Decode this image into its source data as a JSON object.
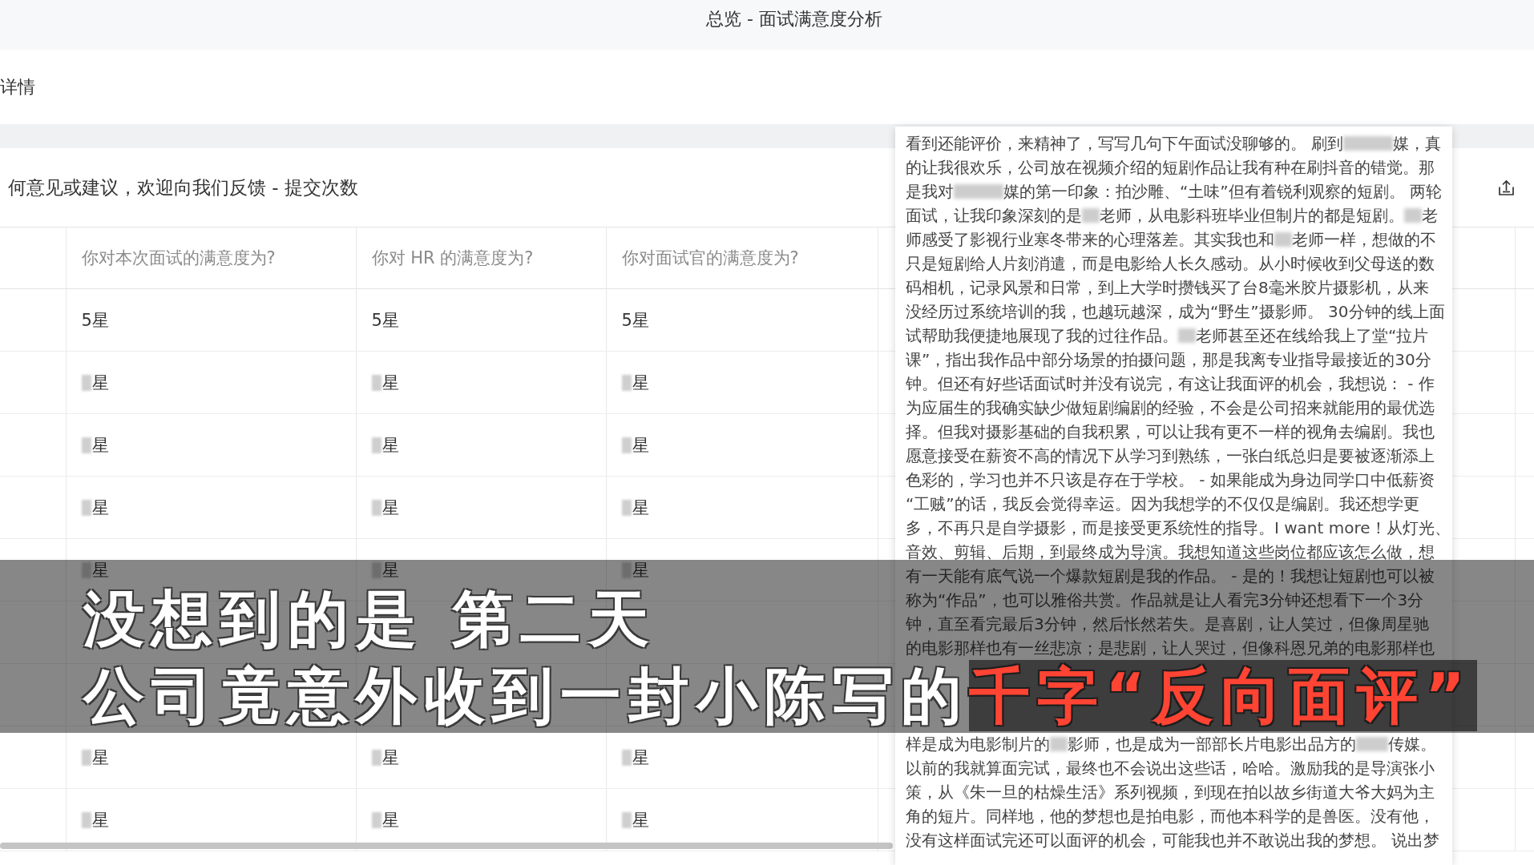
{
  "window": {
    "title": "总览 - 面试满意度分析"
  },
  "page_header": {
    "label": "详情"
  },
  "card": {
    "title": "何意见或建议，欢迎向我们反馈 - 提交次数"
  },
  "table": {
    "columns": [
      {
        "label": "你对本次面试的满意度为?"
      },
      {
        "label": "你对 HR 的满意度为?"
      },
      {
        "label": "你对面试官的满意度为?"
      }
    ],
    "rows": [
      {
        "cells": [
          {
            "text": "5星",
            "blurred": false
          },
          {
            "text": "5星",
            "blurred": false
          },
          {
            "text": "5星",
            "blurred": false
          }
        ]
      },
      {
        "cells": [
          {
            "text": "星",
            "blurred": true
          },
          {
            "text": "星",
            "blurred": true
          },
          {
            "text": "星",
            "blurred": true
          }
        ]
      },
      {
        "cells": [
          {
            "text": "星",
            "blurred": true
          },
          {
            "text": "星",
            "blurred": true
          },
          {
            "text": "星",
            "blurred": true
          }
        ]
      },
      {
        "cells": [
          {
            "text": "星",
            "blurred": true
          },
          {
            "text": "星",
            "blurred": true
          },
          {
            "text": "星",
            "blurred": true
          }
        ]
      },
      {
        "cells": [
          {
            "text": "星",
            "blurred": true
          },
          {
            "text": "星",
            "blurred": true
          },
          {
            "text": "星",
            "blurred": true
          }
        ]
      }
    ],
    "rows_after_caption": [
      {
        "cells": [
          {
            "text": "星",
            "blurred": true
          },
          {
            "text": "星",
            "blurred": true
          },
          {
            "text": "星",
            "blurred": true
          }
        ]
      },
      {
        "cells": [
          {
            "text": "星",
            "blurred": true
          },
          {
            "text": "星",
            "blurred": true
          },
          {
            "text": "星",
            "blurred": true
          }
        ]
      }
    ]
  },
  "review_panel": {
    "paragraphs": [
      {
        "lines": [
          {
            "segments": [
              {
                "kind": "text",
                "text": "看到还能评价，来精神了，写写几句下午面试没聊够的。 刷到"
              },
              {
                "kind": "blur3"
              },
              {
                "kind": "text",
                "text": "媒，真"
              }
            ]
          },
          {
            "segments": [
              {
                "kind": "text",
                "text": "的让我很欢乐，公司放在视频介绍的短剧作品让我有种在刷抖音的错觉。那"
              }
            ]
          },
          {
            "segments": [
              {
                "kind": "text",
                "text": "是我对"
              },
              {
                "kind": "blur3"
              },
              {
                "kind": "text",
                "text": "媒的第一印象：拍沙雕、“土味”但有着锐利观察的短剧。 两轮"
              }
            ]
          },
          {
            "segments": [
              {
                "kind": "text",
                "text": "面试，让我印象深刻的是"
              },
              {
                "kind": "blur1"
              },
              {
                "kind": "text",
                "text": "老师，从电影科班毕业但制片的都是短剧。"
              },
              {
                "kind": "blur1"
              },
              {
                "kind": "text",
                "text": "老"
              }
            ]
          },
          {
            "segments": [
              {
                "kind": "text",
                "text": "师感受了影视行业寒冬带来的心理落差。其实我也和"
              },
              {
                "kind": "blur1"
              },
              {
                "kind": "text",
                "text": "老师一样，想做的不"
              }
            ]
          },
          {
            "segments": [
              {
                "kind": "text",
                "text": "只是短剧给人片刻消遣，而是电影给人长久感动。从小时候收到父母送的数"
              }
            ]
          },
          {
            "segments": [
              {
                "kind": "text",
                "text": "码相机，记录风景和日常，到上大学时攒钱买了台8毫米胶片摄影机，从来"
              }
            ]
          },
          {
            "segments": [
              {
                "kind": "text",
                "text": "没经历过系统培训的我，也越玩越深，成为“野生”摄影师。 30分钟的线上面"
              }
            ]
          },
          {
            "segments": [
              {
                "kind": "text",
                "text": "试帮助我便捷地展现了我的过往作品。"
              },
              {
                "kind": "blur1"
              },
              {
                "kind": "text",
                "text": "老师甚至还在线给我上了堂“拉片"
              }
            ]
          },
          {
            "segments": [
              {
                "kind": "text",
                "text": "课”，指出我作品中部分场景的拍摄问题，那是我离专业指导最接近的30分"
              }
            ]
          },
          {
            "segments": [
              {
                "kind": "text",
                "text": "钟。但还有好些话面试时并没有说完，有这让我面评的机会，我想说： - 作"
              }
            ]
          },
          {
            "segments": [
              {
                "kind": "text",
                "text": "为应届生的我确实缺少做短剧编剧的经验，不会是公司招来就能用的最优选"
              }
            ]
          },
          {
            "segments": [
              {
                "kind": "text",
                "text": "择。但我对摄影基础的自我积累，可以让我有更不一样的视角去编剧。我也"
              }
            ]
          },
          {
            "segments": [
              {
                "kind": "text",
                "text": "愿意接受在薪资不高的情况下从学习到熟练，一张白纸总归是要被逐渐添上"
              }
            ]
          },
          {
            "segments": [
              {
                "kind": "text",
                "text": "色彩的，学习也并不只该是存在于学校。 - 如果能成为身边同学口中低薪资"
              }
            ]
          },
          {
            "segments": [
              {
                "kind": "text",
                "text": "“工贼”的话，我反会觉得幸运。因为我想学的不仅仅是编剧。我还想学更"
              }
            ]
          },
          {
            "segments": [
              {
                "kind": "text",
                "text": "多，不再只是自学摄影，而是接受更系统性的指导。I want more！从灯光、"
              }
            ]
          },
          {
            "segments": [
              {
                "kind": "text",
                "text": "音效、剪辑、后期，到最终成为导演。我想知道这些岗位都应该怎么做，想"
              }
            ]
          },
          {
            "segments": [
              {
                "kind": "text",
                "text": "有一天能有底气说一个爆款短剧是我的作品。 - 是的！我想让短剧也可以被"
              }
            ]
          },
          {
            "segments": [
              {
                "kind": "text",
                "text": "称为“作品”，也可以雅俗共赏。作品就是让人看完3分钟还想看下一个3分"
              }
            ]
          },
          {
            "segments": [
              {
                "kind": "text",
                "text": "钟，直至看完最后3分钟，然后怅然若失。是喜剧，让人笑过，但像周星驰"
              }
            ]
          },
          {
            "segments": [
              {
                "kind": "text",
                "text": "的电影那样也有一丝悲凉；是悲剧，让人哭过，但像科恩兄弟的电影那样也"
              }
            ]
          }
        ]
      },
      {
        "lines": [
          {
            "segments": [
              {
                "kind": "text",
                "text": "样是成为电影制片的"
              },
              {
                "kind": "blur1"
              },
              {
                "kind": "text",
                "text": "影师，也是成为一部部长片电影出品方的"
              },
              {
                "kind": "blur2"
              },
              {
                "kind": "text",
                "text": "传媒。"
              }
            ]
          },
          {
            "segments": [
              {
                "kind": "text",
                "text": "以前的我就算面完试，最终也不会说出这些话，哈哈。激励我的是导演张小"
              }
            ]
          },
          {
            "segments": [
              {
                "kind": "text",
                "text": "策，从《朱一旦的枯燥生活》系列视频，到现在拍以故乡街道大爷大妈为主"
              }
            ]
          },
          {
            "segments": [
              {
                "kind": "text",
                "text": "角的短片。同样地，他的梦想也是拍电影，而他本科学的是兽医。没有他，"
              }
            ]
          },
          {
            "segments": [
              {
                "kind": "text",
                "text": "没有这样面试完还可以面评的机会，可能我也并不敢说出我的梦想。 说出梦"
              }
            ]
          }
        ]
      }
    ]
  },
  "caption": {
    "lines": [
      {
        "segments": [
          {
            "text": "没想到的是 第二天",
            "highlight": false
          }
        ]
      },
      {
        "segments": [
          {
            "text": "公司竟意外收到一封小陈写的",
            "highlight": false
          },
          {
            "text": "千字“反向面评”",
            "highlight": true
          }
        ]
      }
    ]
  }
}
